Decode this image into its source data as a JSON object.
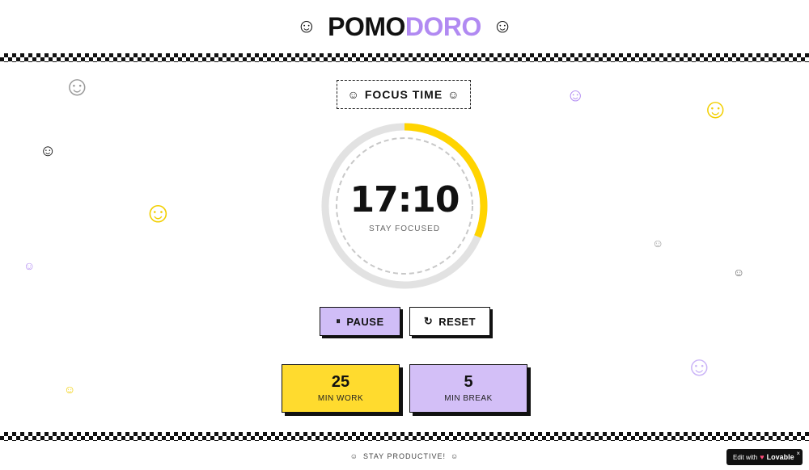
{
  "header": {
    "title_part1": "POMO",
    "title_part2": "DORO",
    "icon_left": "☺",
    "icon_right": "☺"
  },
  "mode": {
    "label": "FOCUS TIME",
    "icon": "☺"
  },
  "timer": {
    "time": "17:10",
    "subtitle": "STAY FOCUSED",
    "progress_fraction": 0.313
  },
  "controls": {
    "pause_label": "PAUSE",
    "pause_icon": "⏸",
    "reset_label": "RESET",
    "reset_icon": "↻"
  },
  "settings": {
    "work_value": "25",
    "work_label": "MIN WORK",
    "break_value": "5",
    "break_label": "MIN BREAK"
  },
  "footer": {
    "text": "STAY PRODUCTIVE!",
    "icon": "☺"
  },
  "badge": {
    "prefix": "Edit with",
    "brand": "Lovable",
    "close": "×"
  },
  "decor": {
    "face": "☺"
  },
  "colors": {
    "accent_purple": "#b18af2",
    "accent_yellow": "#ffd400",
    "pause_bg": "#d0bdf7",
    "break_bg": "#d3bff7",
    "work_bg": "#ffdb2e"
  }
}
